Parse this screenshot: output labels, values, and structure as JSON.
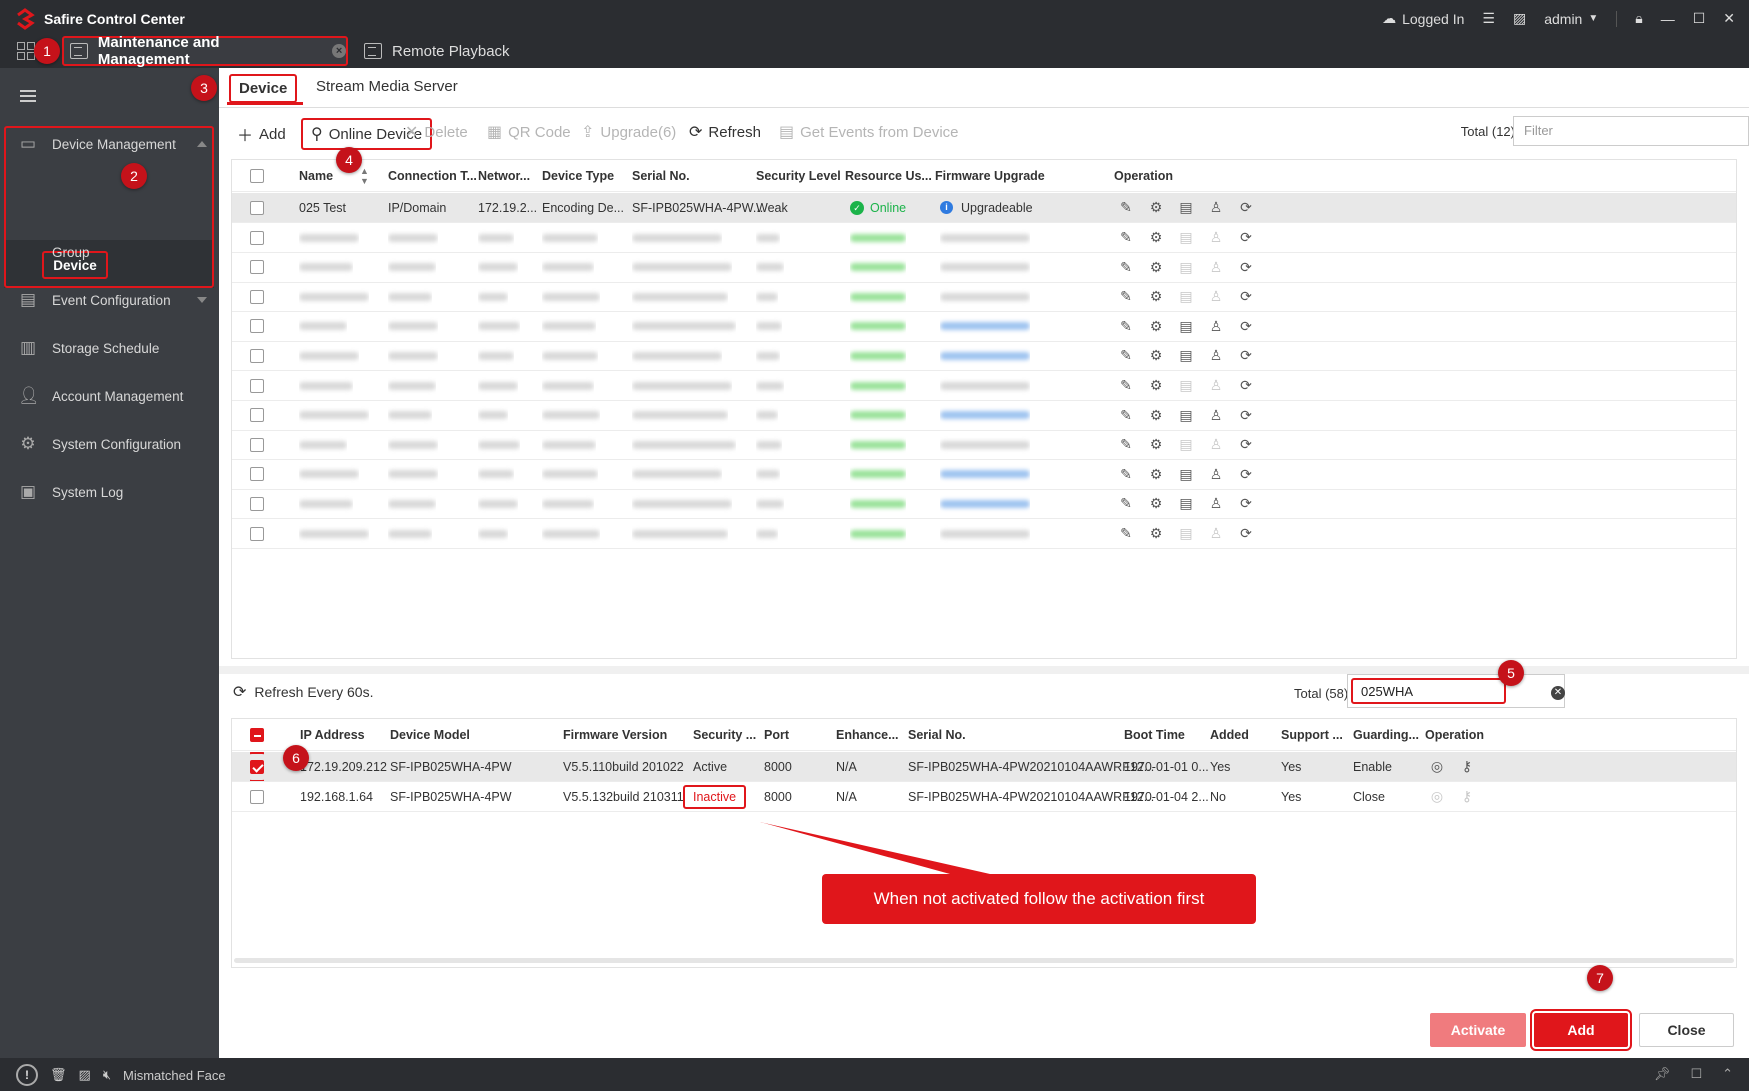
{
  "app": {
    "title": "Safire Control Center",
    "logged_in": "Logged In",
    "user": "admin"
  },
  "tabs": [
    {
      "label": "Maintenance and Management"
    },
    {
      "label": "Remote Playback"
    }
  ],
  "sidebar": {
    "items": [
      {
        "label": "Device Management",
        "icon": "device-icon"
      },
      {
        "label": "Device"
      },
      {
        "label": "Group"
      },
      {
        "label": "Event Configuration",
        "icon": "event-icon"
      },
      {
        "label": "Storage Schedule",
        "icon": "storage-icon"
      },
      {
        "label": "Account Management",
        "icon": "user-icon"
      },
      {
        "label": "System Configuration",
        "icon": "gear-icon"
      },
      {
        "label": "System Log",
        "icon": "log-icon"
      }
    ]
  },
  "subtabs": {
    "device": "Device",
    "stream": "Stream Media Server"
  },
  "toolbar": {
    "add": "Add",
    "online": "Online Device",
    "delete": "Delete",
    "qr": "QR Code",
    "upgrade": "Upgrade(6)",
    "refresh": "Refresh",
    "events": "Get Events from Device",
    "total": "Total (12)",
    "filter_placeholder": "Filter"
  },
  "device_table": {
    "headers": [
      "Name",
      "Connection T...",
      "Networ...",
      "Device Type",
      "Serial No.",
      "Security Level",
      "Resource Us...",
      "Firmware Upgrade",
      "Operation"
    ],
    "first_row": {
      "name": "025 Test",
      "conn": "IP/Domain",
      "net": "172.19.2...",
      "type": "Encoding De...",
      "serial": "SF-IPB025WHA-4PW...",
      "security": "Weak",
      "status": "Online",
      "firmware": "Upgradeable"
    }
  },
  "online": {
    "refresh": "Refresh Every 60s.",
    "total": "Total (58)",
    "search": "025WHA",
    "headers": [
      "IP Address",
      "Device Model",
      "Firmware Version",
      "Security ...",
      "Port",
      "Enhance...",
      "Serial No.",
      "Boot Time",
      "Added",
      "Support ...",
      "Guarding...",
      "Operation"
    ],
    "rows": [
      {
        "ip": "172.19.209.212",
        "model": "SF-IPB025WHA-4PW",
        "fw": "V5.5.110build 201022",
        "security": "Active",
        "port": "8000",
        "enh": "N/A",
        "serial": "SF-IPB025WHA-4PW20210104AAWRF12...",
        "boot": "1970-01-01 0...",
        "added": "Yes",
        "support": "Yes",
        "guard": "Enable"
      },
      {
        "ip": "192.168.1.64",
        "model": "SF-IPB025WHA-4PW",
        "fw": "V5.5.132build 210311",
        "security": "Inactive",
        "port": "8000",
        "enh": "N/A",
        "serial": "SF-IPB025WHA-4PW20210104AAWRF12...",
        "boot": "1970-01-04 2...",
        "added": "No",
        "support": "Yes",
        "guard": "Close"
      }
    ]
  },
  "callout": "When not activated follow the activation first",
  "buttons": {
    "activate": "Activate",
    "add": "Add",
    "close": "Close"
  },
  "status": {
    "text": "Mismatched Face"
  },
  "badges": [
    "1",
    "2",
    "3",
    "4",
    "5",
    "6",
    "7"
  ],
  "colors": {
    "accent": "#e0161b",
    "online": "#1cb34a",
    "info": "#2f7be0"
  }
}
